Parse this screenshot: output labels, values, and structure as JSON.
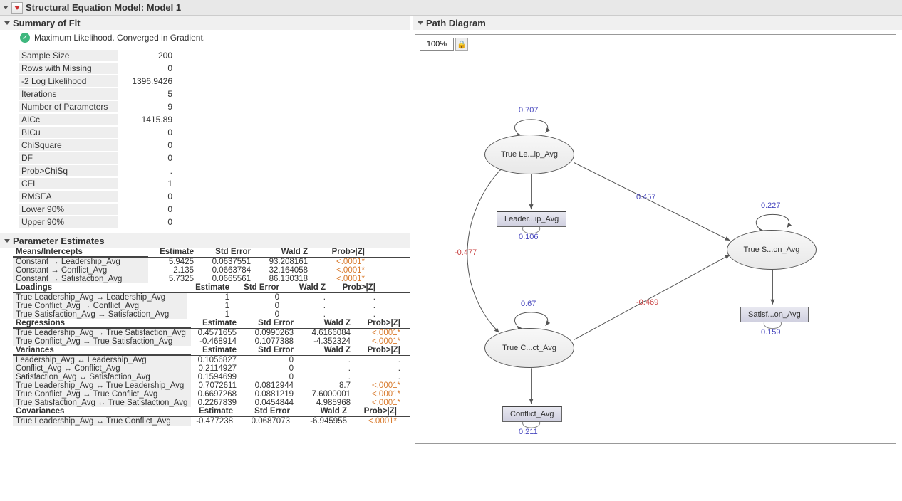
{
  "title": "Structural Equation Model: Model 1",
  "summary": {
    "head": "Summary of Fit",
    "status": "Maximum Likelihood. Converged in Gradient.",
    "rows": [
      {
        "l": "Sample Size",
        "v": "200"
      },
      {
        "l": "Rows with Missing",
        "v": "0"
      },
      {
        "l": "-2 Log Likelihood",
        "v": "1396.9426"
      },
      {
        "l": "Iterations",
        "v": "5"
      },
      {
        "l": "Number of Parameters",
        "v": "9"
      },
      {
        "l": "AICc",
        "v": "1415.89"
      },
      {
        "l": "BICu",
        "v": "0"
      },
      {
        "l": "ChiSquare",
        "v": "0"
      },
      {
        "l": "DF",
        "v": "0"
      },
      {
        "l": "Prob>ChiSq",
        "v": "."
      },
      {
        "l": "CFI",
        "v": "1"
      },
      {
        "l": "RMSEA",
        "v": "0"
      },
      {
        "l": "Lower 90%",
        "v": "0"
      },
      {
        "l": "Upper 90%",
        "v": "0"
      }
    ]
  },
  "pe": {
    "head": "Parameter Estimates",
    "means": {
      "title": "Means/Intercepts",
      "cols": [
        "Estimate",
        "Std Error",
        "Wald Z",
        "Prob>|Z|"
      ],
      "rows": [
        {
          "l": "Constant → Leadership_Avg",
          "e": "5.9425",
          "se": "0.0637551",
          "z": "93.208161",
          "p": "<.0001*"
        },
        {
          "l": "Constant → Conflict_Avg",
          "e": "2.135",
          "se": "0.0663784",
          "z": "32.164058",
          "p": "<.0001*"
        },
        {
          "l": "Constant → Satisfaction_Avg",
          "e": "5.7325",
          "se": "0.0665561",
          "z": "86.130318",
          "p": "<.0001*"
        }
      ]
    },
    "loadings": {
      "title": "Loadings",
      "cols": [
        "Estimate",
        "Std Error",
        "Wald Z",
        "Prob>|Z|"
      ],
      "rows": [
        {
          "l": "True Leadership_Avg → Leadership_Avg",
          "e": "1",
          "se": "0",
          "z": ".",
          "p": "."
        },
        {
          "l": "True Conflict_Avg → Conflict_Avg",
          "e": "1",
          "se": "0",
          "z": ".",
          "p": "."
        },
        {
          "l": "True Satisfaction_Avg → Satisfaction_Avg",
          "e": "1",
          "se": "0",
          "z": ".",
          "p": "."
        }
      ]
    },
    "regs": {
      "title": "Regressions",
      "cols": [
        "Estimate",
        "Std Error",
        "Wald Z",
        "Prob>|Z|"
      ],
      "rows": [
        {
          "l": "True Leadership_Avg → True Satisfaction_Avg",
          "e": "0.4571655",
          "se": "0.0990263",
          "z": "4.6166084",
          "p": "<.0001*"
        },
        {
          "l": "True Conflict_Avg → True Satisfaction_Avg",
          "e": "-0.468914",
          "se": "0.1077388",
          "z": "-4.352324",
          "p": "<.0001*"
        }
      ]
    },
    "vars": {
      "title": "Variances",
      "cols": [
        "Estimate",
        "Std Error",
        "Wald Z",
        "Prob>|Z|"
      ],
      "rows": [
        {
          "l": "Leadership_Avg ↔ Leadership_Avg",
          "e": "0.1056827",
          "se": "0",
          "z": ".",
          "p": "."
        },
        {
          "l": "Conflict_Avg ↔ Conflict_Avg",
          "e": "0.2114927",
          "se": "0",
          "z": ".",
          "p": "."
        },
        {
          "l": "Satisfaction_Avg ↔ Satisfaction_Avg",
          "e": "0.1594699",
          "se": "0",
          "z": ".",
          "p": "."
        },
        {
          "l": "True Leadership_Avg ↔ True Leadership_Avg",
          "e": "0.7072611",
          "se": "0.0812944",
          "z": "8.7",
          "p": "<.0001*"
        },
        {
          "l": "True Conflict_Avg ↔ True Conflict_Avg",
          "e": "0.6697268",
          "se": "0.0881219",
          "z": "7.6000001",
          "p": "<.0001*"
        },
        {
          "l": "True Satisfaction_Avg ↔ True Satisfaction_Avg",
          "e": "0.2267839",
          "se": "0.0454844",
          "z": "4.985968",
          "p": "<.0001*"
        }
      ]
    },
    "covs": {
      "title": "Covariances",
      "cols": [
        "Estimate",
        "Std Error",
        "Wald Z",
        "Prob>|Z|"
      ],
      "rows": [
        {
          "l": "True Leadership_Avg ↔ True Conflict_Avg",
          "e": "-0.477238",
          "se": "0.0687073",
          "z": "-6.945955",
          "p": "<.0001*"
        }
      ]
    }
  },
  "path": {
    "head": "Path Diagram",
    "zoom": "100%",
    "nodes": {
      "lat_lead": "True Le...ip_Avg",
      "lat_conf": "True C...ct_Avg",
      "lat_sat": "True S...on_Avg",
      "man_lead": "Leader...ip_Avg",
      "man_conf": "Conflict_Avg",
      "man_sat": "Satisf...on_Avg"
    },
    "coefs": {
      "v_lead": "0.707",
      "v_conf": "0.67",
      "v_sat": "0.227",
      "e_lead": "0.106",
      "e_conf": "0.211",
      "e_sat": "0.159",
      "r_lead_sat": "0.457",
      "r_conf_sat": "-0.469",
      "c_lead_conf": "-0.477"
    }
  }
}
